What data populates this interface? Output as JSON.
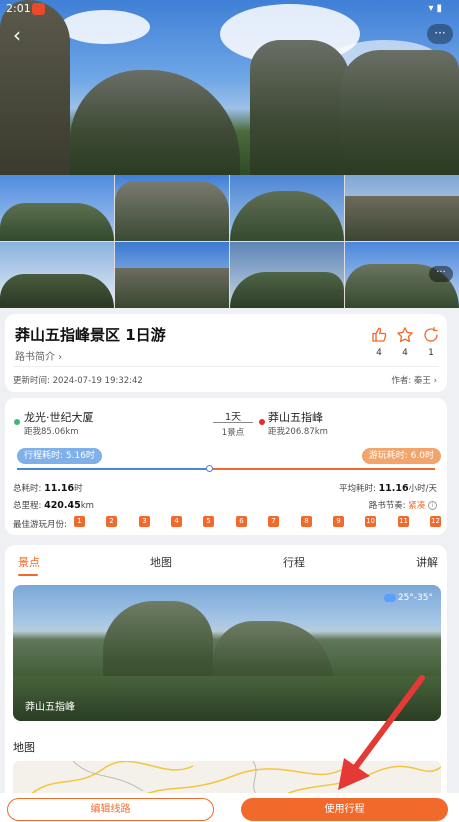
{
  "status": {
    "time": "2:01"
  },
  "hero": {
    "more_label": "···"
  },
  "gallery": {
    "more_label": "···"
  },
  "route": {
    "title": "莽山五指峰景区 1日游",
    "intro": "路书简介 ›",
    "update_time": "更新时间: 2024-07-19 19:32:42",
    "author": "作者: 秦王 ›",
    "actions": [
      {
        "name": "like",
        "count": "4"
      },
      {
        "name": "favorite",
        "count": "4"
      },
      {
        "name": "share",
        "count": "1"
      }
    ]
  },
  "trip": {
    "start_name": "龙光·世纪大厦",
    "start_dist": "距我85.06km",
    "end_name": "莽山五指峰",
    "end_dist": "距我206.87km",
    "days": "1天",
    "spots": "1景点",
    "travel_time": "行程耗时: 5.16时",
    "play_time": "游玩耗时: 6.0时",
    "total_time_label": "总耗时: ",
    "total_time_value": "11.16",
    "total_time_unit": "时",
    "avg_time_label": "平均耗时: ",
    "avg_time_value": "11.16",
    "avg_time_unit": "小时/天",
    "total_distance_label": "总里程: ",
    "total_distance_value": "420.45",
    "total_distance_unit": "km",
    "pace_label": "路书节奏: ",
    "pace_value": "紧凑",
    "best_months_label": "最佳游玩月份:",
    "months": [
      "1",
      "2",
      "3",
      "4",
      "5",
      "6",
      "7",
      "8",
      "9",
      "10",
      "11",
      "12"
    ],
    "travel_fraction": 0.46,
    "colors": {
      "travel": "#4a86d8",
      "play": "#f26a2b"
    }
  },
  "tabs": [
    "景点",
    "地图",
    "行程",
    "讲解"
  ],
  "feature": {
    "spot_name": "莽山五指峰",
    "weather": "25°-35°"
  },
  "map_label": "地图",
  "bottom": {
    "edit_label": "编辑线路",
    "use_label": "使用行程"
  },
  "colors": {
    "accent": "#f26a2b",
    "blue": "#4a86d8"
  }
}
